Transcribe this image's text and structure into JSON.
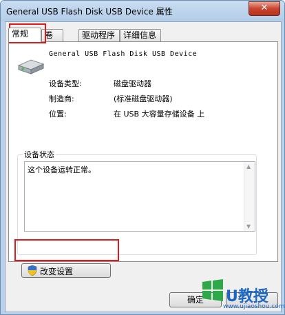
{
  "window": {
    "title": "General USB Flash Disk USB Device 属性",
    "close_label": "✕"
  },
  "tabs": [
    {
      "label": "常规",
      "active": true
    },
    {
      "label": "卷",
      "active": false
    },
    {
      "label": "驱动程序",
      "active": false
    },
    {
      "label": "详细信息",
      "active": false
    }
  ],
  "general": {
    "device_name": "General USB Flash Disk USB Device",
    "properties": [
      {
        "label": "设备类型:",
        "value": "磁盘驱动器"
      },
      {
        "label": "制造商:",
        "value": "(标准磁盘驱动器)"
      },
      {
        "label": "位置:",
        "value": "在 USB 大容量存储设备 上"
      }
    ],
    "status_group_title": "设备状态",
    "status_text": "这个设备运转正常。",
    "change_settings_label": "改变设置"
  },
  "footer": {
    "ok_label": "确定"
  },
  "watermark": {
    "text": "U教授",
    "url": "www.ujiaoshou.com"
  },
  "colors": {
    "highlight": "#e01a1a",
    "title_bar": "#b9d1ea",
    "close_button": "#c8452f"
  },
  "icons": [
    "drive-icon",
    "shield-icon",
    "close-icon",
    "scroll-up-icon",
    "scroll-down-icon"
  ]
}
